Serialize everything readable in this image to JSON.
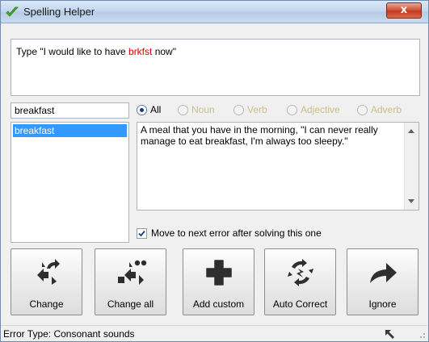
{
  "window": {
    "title": "Spelling Helper",
    "close_label": "x"
  },
  "prompt": {
    "text_before": "Type \"I would like to have ",
    "error_word": "brkfst",
    "text_after": " now\""
  },
  "word_input": {
    "value": "breakfast"
  },
  "suggestions": [
    "breakfast"
  ],
  "word_types": {
    "selected": "All",
    "options": [
      "All",
      "Noun",
      "Verb",
      "Adjective",
      "Adverb"
    ]
  },
  "definition": {
    "text": "A meal that you have in the morning, \"I can never really manage to eat breakfast, I'm always too sleepy.\""
  },
  "move_next": {
    "label": "Move to next error after solving this one",
    "checked": true
  },
  "actions": [
    {
      "label": "Change",
      "icon": "change-icon"
    },
    {
      "label": "Change all",
      "icon": "change-all-icon"
    },
    {
      "label": "Add custom",
      "icon": "plus-icon"
    },
    {
      "label": "Auto Correct",
      "icon": "auto-correct-icon"
    },
    {
      "label": "Ignore",
      "icon": "arrow-right-icon"
    }
  ],
  "status": {
    "text": "Error Type: Consonant sounds"
  },
  "colors": {
    "error_word": "#d40000",
    "selection": "#3399ff",
    "disabled_option": "#c8c08a"
  }
}
